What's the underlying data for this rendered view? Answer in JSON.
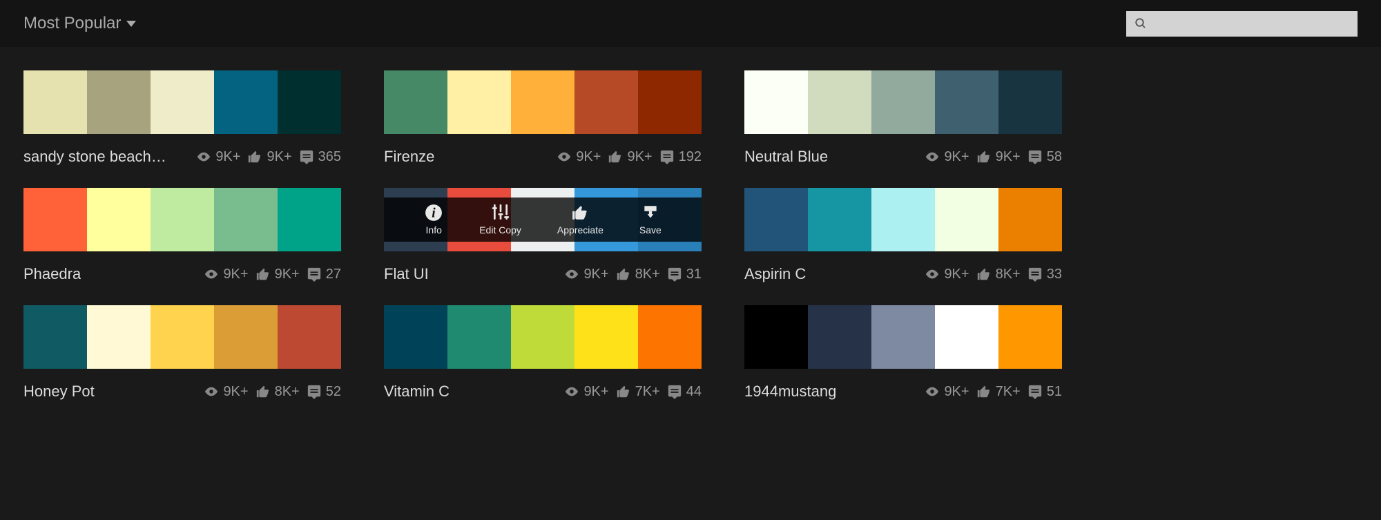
{
  "header": {
    "sort_label": "Most Popular",
    "search_placeholder": ""
  },
  "overlay_actions": {
    "info": "Info",
    "edit_copy": "Edit Copy",
    "appreciate": "Appreciate",
    "save": "Save"
  },
  "palettes": [
    {
      "name": "sandy stone beach ocean ...",
      "colors": [
        "#e6e2af",
        "#a7a37e",
        "#efecca",
        "#046380",
        "#002f2f"
      ],
      "views": "9K+",
      "likes": "9K+",
      "comments": "365",
      "hover": false
    },
    {
      "name": "Firenze",
      "colors": [
        "#468966",
        "#fff0a5",
        "#ffb03b",
        "#b64926",
        "#8e2800"
      ],
      "views": "9K+",
      "likes": "9K+",
      "comments": "192",
      "hover": false
    },
    {
      "name": "Neutral Blue",
      "colors": [
        "#fcfff5",
        "#d1dbbd",
        "#91aa9d",
        "#3e606f",
        "#193441"
      ],
      "views": "9K+",
      "likes": "9K+",
      "comments": "58",
      "hover": false
    },
    {
      "name": "Phaedra",
      "colors": [
        "#ff6138",
        "#ffff9d",
        "#beeb9f",
        "#79bd8f",
        "#00a388"
      ],
      "views": "9K+",
      "likes": "9K+",
      "comments": "27",
      "hover": false
    },
    {
      "name": "Flat UI",
      "colors": [
        "#2c3e50",
        "#e74c3c",
        "#ecf0f1",
        "#3498db",
        "#2980b9"
      ],
      "views": "9K+",
      "likes": "8K+",
      "comments": "31",
      "hover": true
    },
    {
      "name": "Aspirin C",
      "colors": [
        "#225378",
        "#1695a3",
        "#acf0f2",
        "#f3ffe2",
        "#eb7f00"
      ],
      "views": "9K+",
      "likes": "8K+",
      "comments": "33",
      "hover": false
    },
    {
      "name": "Honey Pot",
      "colors": [
        "#105b63",
        "#fffad5",
        "#ffd34e",
        "#db9e36",
        "#bd4932"
      ],
      "views": "9K+",
      "likes": "8K+",
      "comments": "52",
      "hover": false
    },
    {
      "name": "Vitamin C",
      "colors": [
        "#004358",
        "#1f8a70",
        "#bedb39",
        "#ffe11a",
        "#fd7400"
      ],
      "views": "9K+",
      "likes": "7K+",
      "comments": "44",
      "hover": false
    },
    {
      "name": "1944mustang",
      "colors": [
        "#000000",
        "#263248",
        "#7e8aa2",
        "#ffffff",
        "#ff9800"
      ],
      "views": "9K+",
      "likes": "7K+",
      "comments": "51",
      "hover": false
    }
  ]
}
